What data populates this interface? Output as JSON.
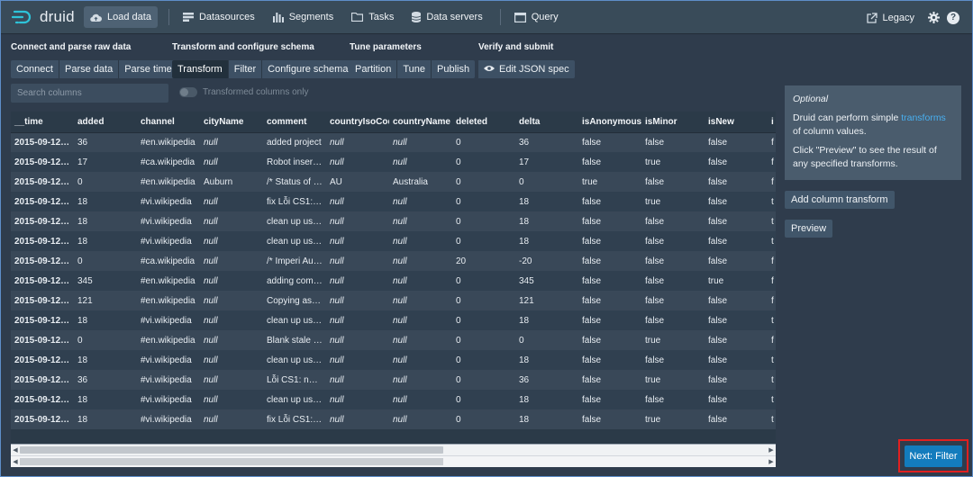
{
  "app": {
    "logo_text": "druid"
  },
  "nav": {
    "items": [
      {
        "label": "Load data",
        "icon": "cloud-upload-icon",
        "active": true
      },
      {
        "label": "Datasources",
        "icon": "datasources-icon"
      },
      {
        "label": "Segments",
        "icon": "segments-icon"
      },
      {
        "label": "Tasks",
        "icon": "tasks-icon"
      },
      {
        "label": "Data servers",
        "icon": "database-icon"
      },
      {
        "label": "Query",
        "icon": "query-icon"
      }
    ],
    "legacy_label": "Legacy"
  },
  "steps": {
    "connect": {
      "title": "Connect and parse raw data",
      "buttons": [
        "Connect",
        "Parse data",
        "Parse time"
      ]
    },
    "transform": {
      "title": "Transform and configure schema",
      "buttons": [
        "Transform",
        "Filter",
        "Configure schema"
      ],
      "active": "Transform"
    },
    "tune": {
      "title": "Tune parameters",
      "buttons": [
        "Partition",
        "Tune",
        "Publish"
      ]
    },
    "verify": {
      "title": "Verify and submit",
      "buttons": [
        "Edit JSON spec"
      ]
    }
  },
  "search": {
    "placeholder": "Search columns"
  },
  "toggle": {
    "label": "Transformed columns only"
  },
  "table": {
    "columns": [
      "__time",
      "added",
      "channel",
      "cityName",
      "comment",
      "countryIsoCod",
      "countryName",
      "deleted",
      "delta",
      "isAnonymous",
      "isMinor",
      "isNew",
      "i"
    ],
    "rows": [
      [
        "2015-09-12T…",
        "36",
        "#en.wikipedia",
        "null",
        "added project",
        "null",
        "null",
        "0",
        "36",
        "false",
        "false",
        "false",
        "f"
      ],
      [
        "2015-09-12T…",
        "17",
        "#ca.wikipedia",
        "null",
        "Robot inserta…",
        "null",
        "null",
        "0",
        "17",
        "false",
        "true",
        "false",
        "f"
      ],
      [
        "2015-09-12T…",
        "0",
        "#en.wikipedia",
        "Auburn",
        "/* Status of p…",
        "AU",
        "Australia",
        "0",
        "0",
        "true",
        "false",
        "false",
        "f"
      ],
      [
        "2015-09-12T…",
        "18",
        "#vi.wikipedia",
        "null",
        "fix Lỗi CS1: n…",
        "null",
        "null",
        "0",
        "18",
        "false",
        "true",
        "false",
        "t"
      ],
      [
        "2015-09-12T…",
        "18",
        "#vi.wikipedia",
        "null",
        "clean up usin…",
        "null",
        "null",
        "0",
        "18",
        "false",
        "false",
        "false",
        "t"
      ],
      [
        "2015-09-12T…",
        "18",
        "#vi.wikipedia",
        "null",
        "clean up usin…",
        "null",
        "null",
        "0",
        "18",
        "false",
        "false",
        "false",
        "t"
      ],
      [
        "2015-09-12T…",
        "0",
        "#ca.wikipedia",
        "null",
        "/* Imperi Aus…",
        "null",
        "null",
        "20",
        "-20",
        "false",
        "false",
        "false",
        "f"
      ],
      [
        "2015-09-12T…",
        "345",
        "#en.wikipedia",
        "null",
        "adding comm…",
        "null",
        "null",
        "0",
        "345",
        "false",
        "false",
        "true",
        "f"
      ],
      [
        "2015-09-12T…",
        "121",
        "#en.wikipedia",
        "null",
        "Copying asse…",
        "null",
        "null",
        "0",
        "121",
        "false",
        "false",
        "false",
        "f"
      ],
      [
        "2015-09-12T…",
        "18",
        "#vi.wikipedia",
        "null",
        "clean up usin…",
        "null",
        "null",
        "0",
        "18",
        "false",
        "false",
        "false",
        "t"
      ],
      [
        "2015-09-12T…",
        "0",
        "#en.wikipedia",
        "null",
        "Blank stale w…",
        "null",
        "null",
        "0",
        "0",
        "false",
        "true",
        "false",
        "f"
      ],
      [
        "2015-09-12T…",
        "18",
        "#vi.wikipedia",
        "null",
        "clean up usin…",
        "null",
        "null",
        "0",
        "18",
        "false",
        "false",
        "false",
        "t"
      ],
      [
        "2015-09-12T…",
        "36",
        "#vi.wikipedia",
        "null",
        "Lỗi CS1: ngày…",
        "null",
        "null",
        "0",
        "36",
        "false",
        "true",
        "false",
        "t"
      ],
      [
        "2015-09-12T…",
        "18",
        "#vi.wikipedia",
        "null",
        "clean up usin…",
        "null",
        "null",
        "0",
        "18",
        "false",
        "false",
        "false",
        "t"
      ],
      [
        "2015-09-12T…",
        "18",
        "#vi.wikipedia",
        "null",
        "fix Lỗi CS1: n…",
        "null",
        "null",
        "0",
        "18",
        "false",
        "true",
        "false",
        "t"
      ]
    ]
  },
  "panel": {
    "optional": "Optional",
    "text_before_link": "Druid can perform simple ",
    "link": "transforms",
    "text_after_link": " of column values.",
    "preview_hint": "Click \"Preview\" to see the result of any specified transforms.",
    "add_transform_label": "Add column transform",
    "preview_label": "Preview"
  },
  "next_button": {
    "label": "Next: Filter"
  },
  "colors": {
    "primary": "#137cbd",
    "link": "#48aff0",
    "highlight": "#e02020"
  }
}
